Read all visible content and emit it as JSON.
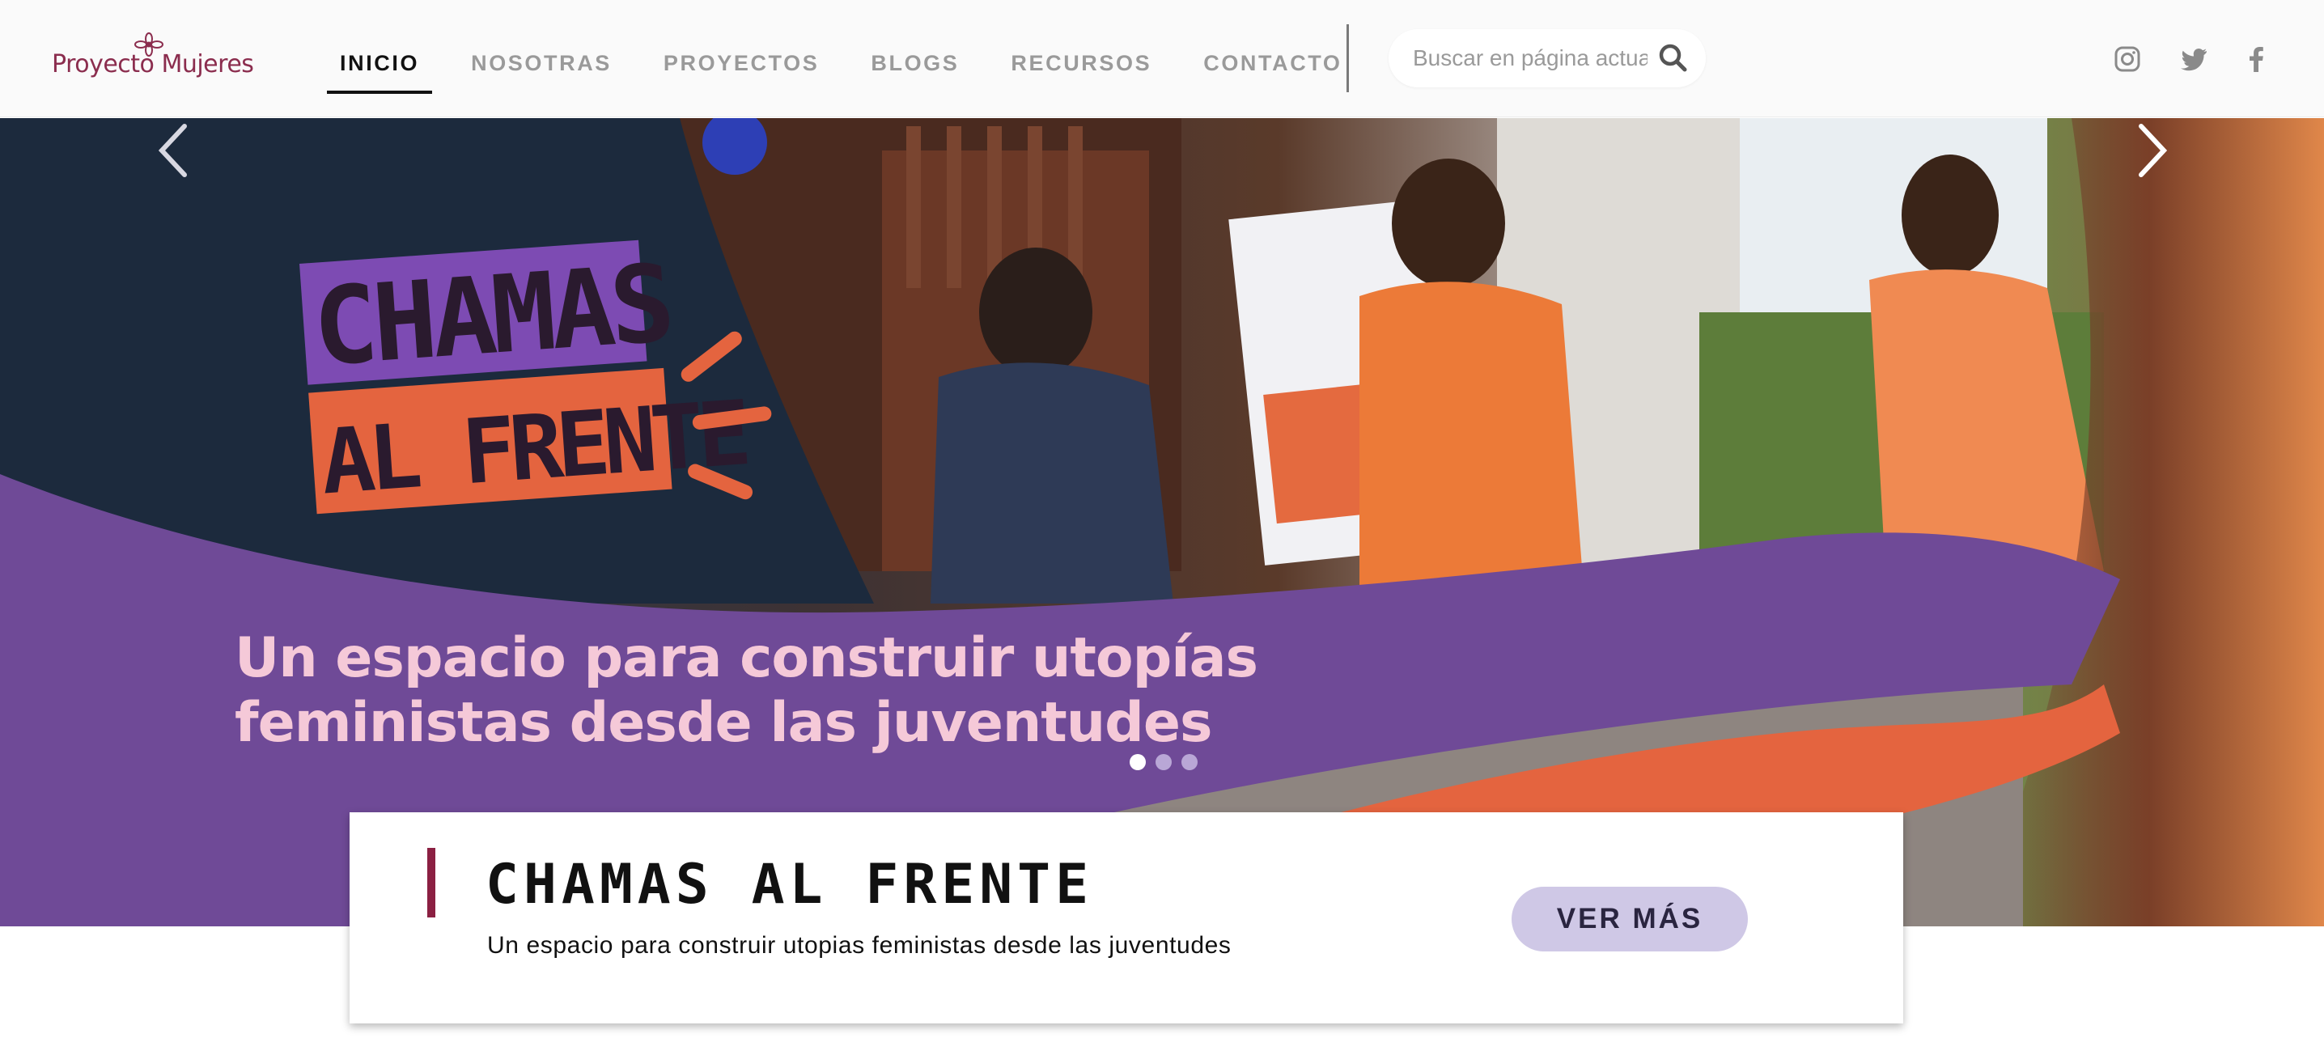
{
  "header": {
    "logo_text": "Proyecto Mujeres",
    "nav": [
      {
        "label": "INICIO",
        "active": true
      },
      {
        "label": "NOSOTRAS",
        "active": false
      },
      {
        "label": "PROYECTOS",
        "active": false
      },
      {
        "label": "BLOGS",
        "active": false
      },
      {
        "label": "RECURSOS",
        "active": false
      },
      {
        "label": "CONTACTO",
        "active": false
      }
    ],
    "search": {
      "placeholder": "Buscar en página actual",
      "icon": "search-icon"
    },
    "social": [
      "instagram-icon",
      "twitter-icon",
      "facebook-icon"
    ]
  },
  "hero": {
    "logo_line1": "CHAMAS",
    "logo_line2": "AL FRENTE",
    "title_line1": "Un espacio para construir utopías",
    "title_line2": "feministas desde las juventudes",
    "slides": 3,
    "active_slide": 1
  },
  "card": {
    "title": "CHAMAS AL FRENTE",
    "subtitle": "Un espacio para construir utopias feministas desde las juventudes",
    "button_label": "VER MÁS"
  },
  "colors": {
    "brand": "#8b2d4e",
    "purple": "#6f4a97",
    "orange": "#e4643f",
    "button": "#cfc8e6"
  }
}
